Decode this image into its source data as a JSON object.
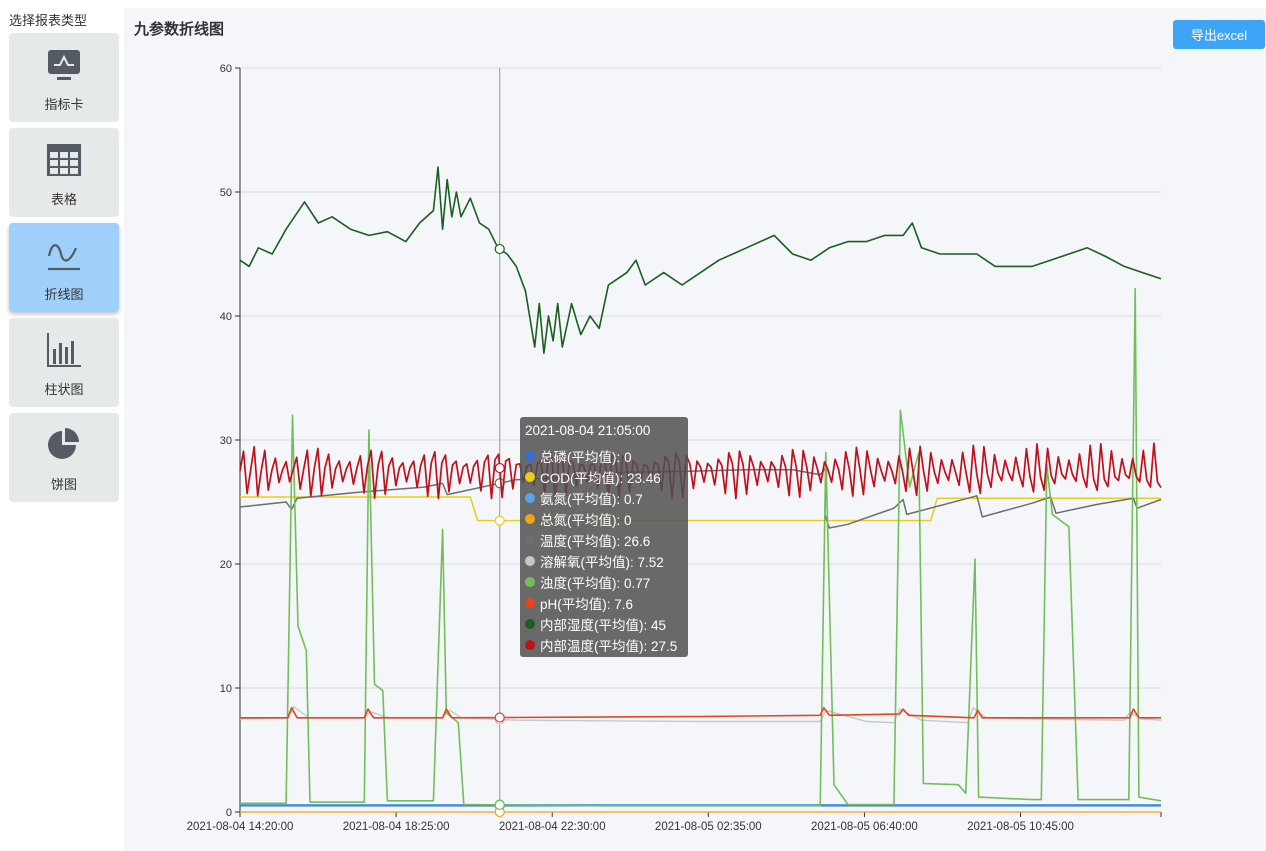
{
  "sidebar": {
    "title": "选择报表类型",
    "items": [
      {
        "label": "指标卡",
        "icon": "indicator-card-icon",
        "active": false
      },
      {
        "label": "表格",
        "icon": "table-icon",
        "active": false
      },
      {
        "label": "折线图",
        "icon": "line-chart-icon",
        "active": true
      },
      {
        "label": "柱状图",
        "icon": "bar-chart-icon",
        "active": false
      },
      {
        "label": "饼图",
        "icon": "pie-chart-icon",
        "active": false
      }
    ]
  },
  "panel": {
    "title": "九参数折线图",
    "export_label": "导出excel"
  },
  "colors": {
    "accent": "#3ea4f5",
    "active_item": "#9fd0fb",
    "inactive_item": "#e6e9ea"
  },
  "tooltip": {
    "time": "2021-08-04 21:05:00",
    "rows": [
      {
        "label": "总磷(平均值): 0",
        "color": "#2f6fd6"
      },
      {
        "label": "COD(平均值): 23.46",
        "color": "#e8cf1b"
      },
      {
        "label": "氨氮(平均值): 0.7",
        "color": "#5ba4e0"
      },
      {
        "label": "总氮(平均值): 0",
        "color": "#f4a21c"
      },
      {
        "label": "温度(平均值): 26.6",
        "color": "#6d6d6d"
      },
      {
        "label": "溶解氧(平均值): 7.52",
        "color": "#c7c7c7"
      },
      {
        "label": "浊度(平均值): 0.77",
        "color": "#72bf5a"
      },
      {
        "label": "pH(平均值): 7.6",
        "color": "#e8431e"
      },
      {
        "label": "内部湿度(平均值): 45",
        "color": "#1b5e20"
      },
      {
        "label": "内部温度(平均值): 27.5",
        "color": "#c0101a"
      }
    ]
  },
  "chart_data": {
    "type": "line",
    "ylim": [
      0,
      60
    ],
    "yticks": [
      0,
      10,
      20,
      30,
      40,
      50,
      60
    ],
    "x_tick_labels": [
      "2021-08-04 14:20:00",
      "2021-08-04 18:25:00",
      "2021-08-04 22:30:00",
      "2021-08-05 02:35:00",
      "2021-08-05 06:40:00",
      "2021-08-05 10:45:00"
    ],
    "x_range": [
      0,
      1
    ],
    "x_ticks_pos": [
      0.0,
      0.1695,
      0.339,
      0.5085,
      0.678,
      0.8475
    ],
    "cursor_x": 0.282,
    "grid": true,
    "series": [
      {
        "name": "总磷(平均值)",
        "color": "#2f6fd6",
        "width": 1.3,
        "points": [
          [
            0,
            0.5
          ],
          [
            1,
            0.5
          ]
        ]
      },
      {
        "name": "COD(平均值)",
        "color": "#e8cf1b",
        "width": 1.5,
        "points": [
          [
            0,
            25.4
          ],
          [
            0.25,
            25.4
          ],
          [
            0.258,
            23.5
          ],
          [
            0.75,
            23.5
          ],
          [
            0.757,
            25.3
          ],
          [
            1,
            25.3
          ]
        ]
      },
      {
        "name": "氨氮(平均值)",
        "color": "#5ba4e0",
        "width": 1.3,
        "points": [
          [
            0,
            0.6
          ],
          [
            1,
            0.6
          ]
        ]
      },
      {
        "name": "总氮(平均值)",
        "color": "#f4a21c",
        "width": 1.3,
        "points": [
          [
            0,
            0
          ],
          [
            1,
            0
          ]
        ]
      },
      {
        "name": "温度(平均值)",
        "color": "#6d6d6d",
        "width": 1.5,
        "points": [
          [
            0,
            24.6
          ],
          [
            0.05,
            25.0
          ],
          [
            0.056,
            24.4
          ],
          [
            0.062,
            25.3
          ],
          [
            0.13,
            25.8
          ],
          [
            0.2,
            26.2
          ],
          [
            0.22,
            26.5
          ],
          [
            0.225,
            25.6
          ],
          [
            0.3,
            26.8
          ],
          [
            0.35,
            27.0
          ],
          [
            0.42,
            27.4
          ],
          [
            0.5,
            27.5
          ],
          [
            0.55,
            27.6
          ],
          [
            0.6,
            27.6
          ],
          [
            0.63,
            27.2
          ],
          [
            0.637,
            27.8
          ],
          [
            0.635,
            24.0
          ],
          [
            0.64,
            22.9
          ],
          [
            0.66,
            23.2
          ],
          [
            0.71,
            24.5
          ],
          [
            0.72,
            25.2
          ],
          [
            0.724,
            24.0
          ],
          [
            0.79,
            25.3
          ],
          [
            0.8,
            25.5
          ],
          [
            0.806,
            23.8
          ],
          [
            0.86,
            24.9
          ],
          [
            0.88,
            25.4
          ],
          [
            0.886,
            24.1
          ],
          [
            0.93,
            24.8
          ],
          [
            0.97,
            25.3
          ],
          [
            0.974,
            24.5
          ],
          [
            1,
            25.2
          ]
        ]
      },
      {
        "name": "溶解氧(平均值)",
        "color": "#c7c7c7",
        "width": 1.4,
        "points": [
          [
            0,
            7.5
          ],
          [
            0.052,
            7.6
          ],
          [
            0.058,
            8.5
          ],
          [
            0.075,
            7.6
          ],
          [
            0.135,
            7.6
          ],
          [
            0.142,
            8.1
          ],
          [
            0.16,
            7.6
          ],
          [
            0.22,
            7.6
          ],
          [
            0.228,
            8.2
          ],
          [
            0.24,
            7.6
          ],
          [
            0.3,
            7.4
          ],
          [
            0.5,
            7.3
          ],
          [
            0.63,
            7.3
          ],
          [
            0.636,
            8.2
          ],
          [
            0.68,
            7.3
          ],
          [
            0.71,
            7.2
          ],
          [
            0.716,
            8.3
          ],
          [
            0.74,
            7.4
          ],
          [
            0.79,
            7.2
          ],
          [
            0.796,
            8.4
          ],
          [
            0.81,
            7.6
          ],
          [
            0.86,
            7.5
          ],
          [
            0.96,
            7.4
          ],
          [
            0.966,
            8.0
          ],
          [
            0.98,
            7.5
          ],
          [
            1,
            7.4
          ]
        ]
      },
      {
        "name": "浊度(平均值)",
        "color": "#72bf5a",
        "width": 1.6,
        "points": [
          [
            0,
            0.7
          ],
          [
            0.05,
            0.7
          ],
          [
            0.057,
            32
          ],
          [
            0.063,
            15
          ],
          [
            0.072,
            13
          ],
          [
            0.076,
            0.8
          ],
          [
            0.135,
            0.8
          ],
          [
            0.14,
            30.8
          ],
          [
            0.146,
            10.3
          ],
          [
            0.155,
            9.8
          ],
          [
            0.16,
            0.9
          ],
          [
            0.21,
            0.9
          ],
          [
            0.22,
            22.8
          ],
          [
            0.224,
            8
          ],
          [
            0.237,
            7.2
          ],
          [
            0.243,
            0.6
          ],
          [
            0.4,
            0.5
          ],
          [
            0.5,
            0.5
          ],
          [
            0.63,
            0.5
          ],
          [
            0.636,
            29
          ],
          [
            0.645,
            2.2
          ],
          [
            0.66,
            0.6
          ],
          [
            0.71,
            0.6
          ],
          [
            0.717,
            32.4
          ],
          [
            0.727,
            26.2
          ],
          [
            0.737,
            29
          ],
          [
            0.742,
            2.3
          ],
          [
            0.78,
            2.2
          ],
          [
            0.788,
            1.5
          ],
          [
            0.798,
            20.4
          ],
          [
            0.802,
            1.2
          ],
          [
            0.86,
            1.0
          ],
          [
            0.87,
            1.0
          ],
          [
            0.876,
            28
          ],
          [
            0.882,
            24
          ],
          [
            0.9,
            23
          ],
          [
            0.91,
            1.0
          ],
          [
            0.965,
            1.0
          ],
          [
            0.972,
            42.2
          ],
          [
            0.976,
            1.2
          ],
          [
            1,
            0.9
          ]
        ]
      },
      {
        "name": "pH(平均值)",
        "color": "#e8431e",
        "width": 1.6,
        "points": [
          [
            0,
            7.6
          ],
          [
            0.052,
            7.6
          ],
          [
            0.056,
            8.4
          ],
          [
            0.062,
            7.6
          ],
          [
            0.135,
            7.6
          ],
          [
            0.139,
            8.3
          ],
          [
            0.145,
            7.6
          ],
          [
            0.22,
            7.6
          ],
          [
            0.224,
            8.3
          ],
          [
            0.23,
            7.6
          ],
          [
            0.5,
            7.7
          ],
          [
            0.63,
            7.8
          ],
          [
            0.634,
            8.4
          ],
          [
            0.64,
            7.8
          ],
          [
            0.716,
            7.9
          ],
          [
            0.72,
            8.3
          ],
          [
            0.726,
            7.8
          ],
          [
            0.797,
            7.6
          ],
          [
            0.801,
            8.2
          ],
          [
            0.806,
            7.6
          ],
          [
            0.966,
            7.6
          ],
          [
            0.97,
            8.3
          ],
          [
            0.976,
            7.6
          ],
          [
            1,
            7.6
          ]
        ]
      },
      {
        "name": "内部湿度(平均值)",
        "color": "#1b5e20",
        "width": 1.6,
        "points": [
          [
            0,
            44.5
          ],
          [
            0.01,
            44.0
          ],
          [
            0.02,
            45.5
          ],
          [
            0.035,
            45.0
          ],
          [
            0.05,
            47.0
          ],
          [
            0.07,
            49.2
          ],
          [
            0.085,
            47.5
          ],
          [
            0.1,
            48.0
          ],
          [
            0.12,
            47.0
          ],
          [
            0.14,
            46.5
          ],
          [
            0.16,
            46.8
          ],
          [
            0.18,
            46.0
          ],
          [
            0.195,
            47.5
          ],
          [
            0.21,
            48.5
          ],
          [
            0.215,
            52
          ],
          [
            0.22,
            47
          ],
          [
            0.225,
            51
          ],
          [
            0.23,
            48
          ],
          [
            0.235,
            50
          ],
          [
            0.24,
            48
          ],
          [
            0.25,
            49.5
          ],
          [
            0.26,
            47.5
          ],
          [
            0.27,
            47
          ],
          [
            0.28,
            45.5
          ],
          [
            0.29,
            45
          ],
          [
            0.3,
            44
          ],
          [
            0.31,
            42
          ],
          [
            0.32,
            37.5
          ],
          [
            0.325,
            41
          ],
          [
            0.33,
            37
          ],
          [
            0.335,
            40
          ],
          [
            0.34,
            38
          ],
          [
            0.345,
            41
          ],
          [
            0.35,
            37.5
          ],
          [
            0.36,
            41
          ],
          [
            0.37,
            38.5
          ],
          [
            0.38,
            40
          ],
          [
            0.39,
            39
          ],
          [
            0.4,
            42.5
          ],
          [
            0.41,
            43
          ],
          [
            0.42,
            43.5
          ],
          [
            0.43,
            44.5
          ],
          [
            0.44,
            42.5
          ],
          [
            0.46,
            43.5
          ],
          [
            0.48,
            42.5
          ],
          [
            0.5,
            43.5
          ],
          [
            0.52,
            44.5
          ],
          [
            0.55,
            45.5
          ],
          [
            0.58,
            46.5
          ],
          [
            0.6,
            45
          ],
          [
            0.62,
            44.5
          ],
          [
            0.64,
            45.5
          ],
          [
            0.66,
            46
          ],
          [
            0.68,
            46
          ],
          [
            0.7,
            46.5
          ],
          [
            0.72,
            46.5
          ],
          [
            0.73,
            47.5
          ],
          [
            0.74,
            45.5
          ],
          [
            0.76,
            45
          ],
          [
            0.78,
            45
          ],
          [
            0.8,
            45
          ],
          [
            0.82,
            44
          ],
          [
            0.84,
            44
          ],
          [
            0.86,
            44
          ],
          [
            0.88,
            44.5
          ],
          [
            0.9,
            45
          ],
          [
            0.92,
            45.5
          ],
          [
            0.94,
            44.8
          ],
          [
            0.96,
            44
          ],
          [
            0.98,
            43.5
          ],
          [
            1,
            43
          ]
        ]
      },
      {
        "name": "内部温度(平均值)",
        "color": "#c0101a",
        "width": 1.7,
        "points": [
          [
            0,
            27.5
          ],
          [
            1,
            27.5
          ]
        ]
      }
    ]
  }
}
